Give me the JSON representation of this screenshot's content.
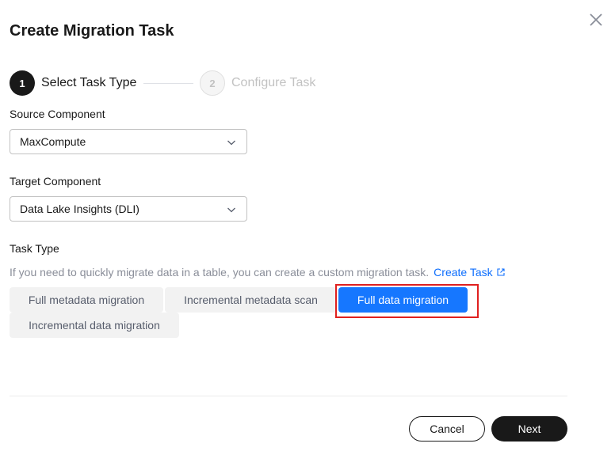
{
  "dialog": {
    "title": "Create Migration Task",
    "close_icon": "close-icon"
  },
  "steps": [
    {
      "number": "1",
      "label": "Select Task Type",
      "state": "active"
    },
    {
      "number": "2",
      "label": "Configure Task",
      "state": "pending"
    }
  ],
  "form": {
    "source": {
      "label": "Source Component",
      "value": "MaxCompute"
    },
    "target": {
      "label": "Target Component",
      "value": "Data Lake Insights (DLI)"
    },
    "task_type": {
      "label": "Task Type",
      "hint": "If you need to quickly migrate data in a table, you can create a custom migration task.",
      "link": "Create Task",
      "options": [
        {
          "label": "Full metadata migration",
          "selected": false
        },
        {
          "label": "Incremental metadata scan",
          "selected": false
        },
        {
          "label": "Full data migration",
          "selected": true
        },
        {
          "label": "Incremental data migration",
          "selected": false
        }
      ]
    }
  },
  "footer": {
    "cancel_label": "Cancel",
    "next_label": "Next"
  },
  "colors": {
    "accent": "#1677ff",
    "primary_dark": "#191919",
    "highlight": "#e0201f"
  }
}
